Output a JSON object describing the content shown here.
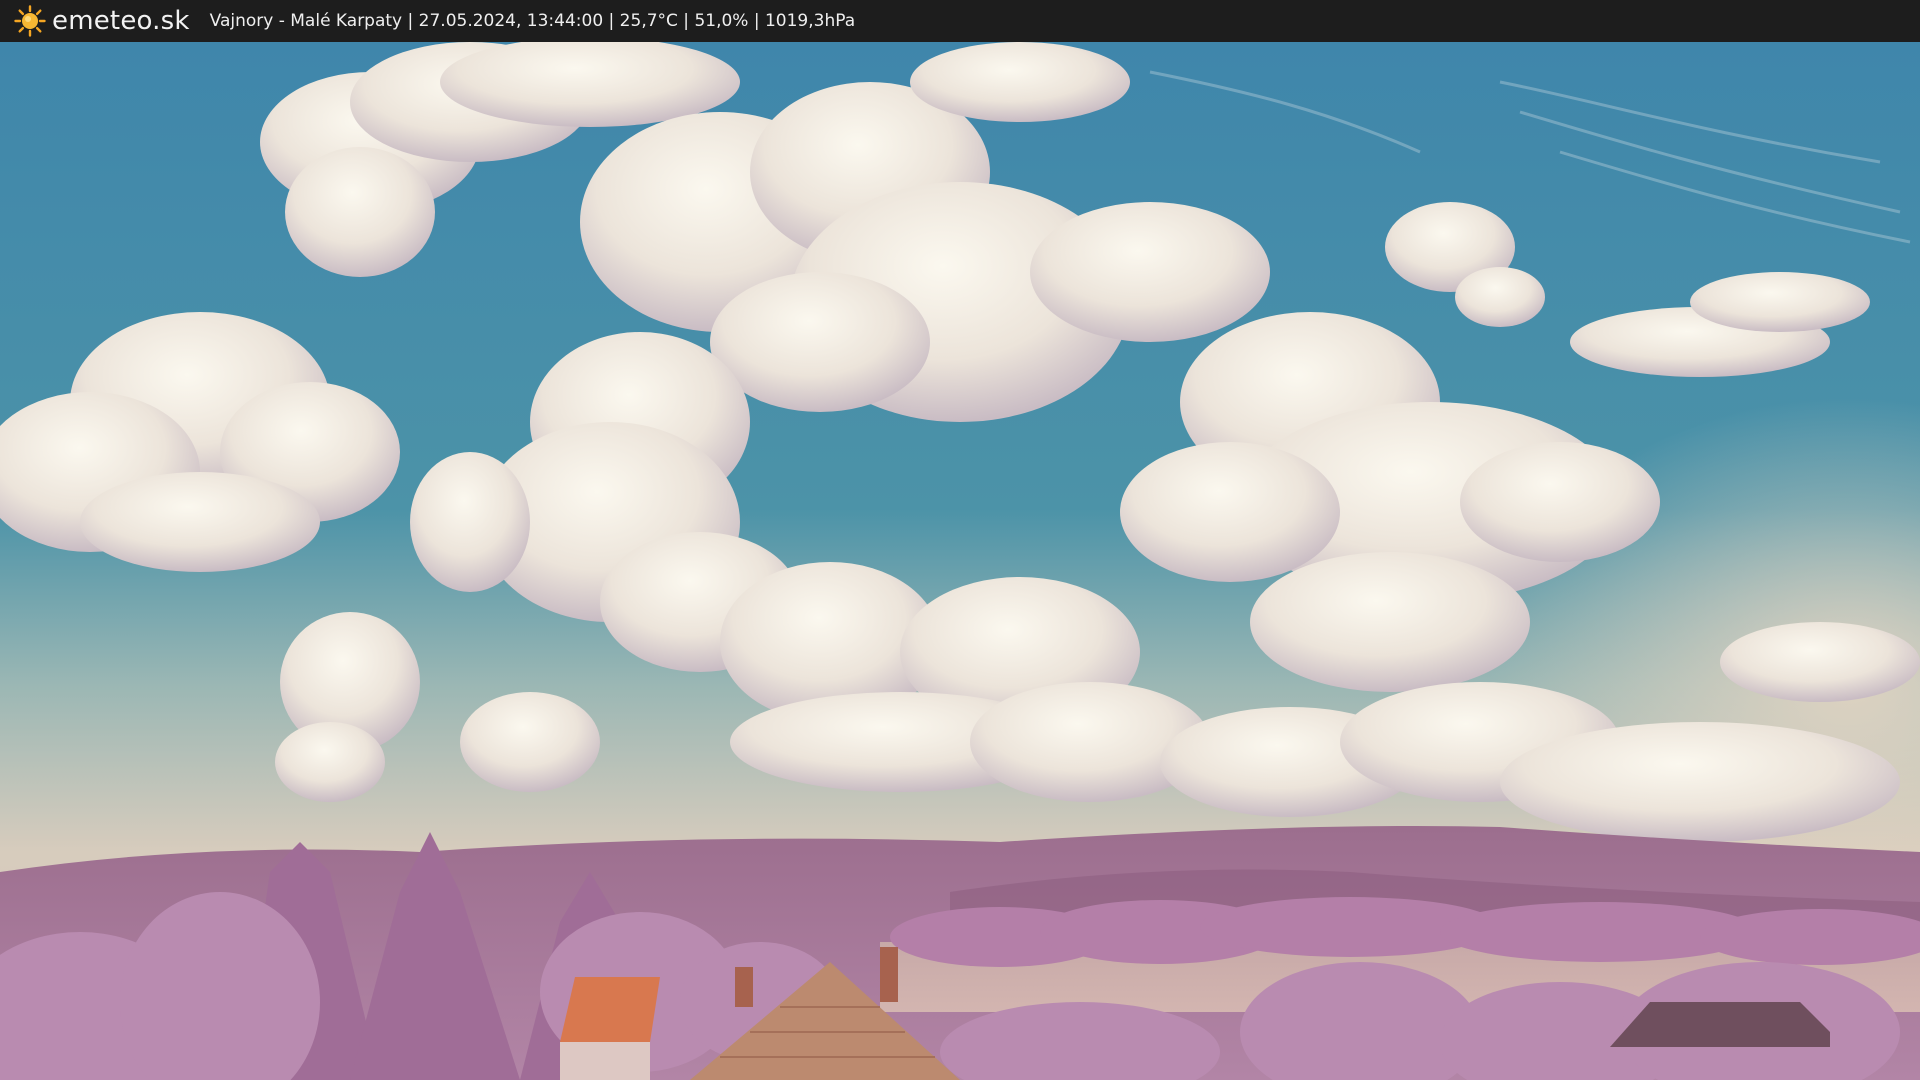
{
  "header": {
    "brand": "emeteo.sk",
    "logo_icon": "sun-icon",
    "caption": "Vajnory - Malé Karpaty | 27.05.2024, 13:44:00 | 25,7°C | 51,0% | 1019,3hPa"
  },
  "colors": {
    "bar": "#1d1d1d",
    "sun": "#f5a623",
    "sky_top": "#3d7fa3",
    "sky_low": "#d9cdbf",
    "foliage": "#b07aa6"
  }
}
